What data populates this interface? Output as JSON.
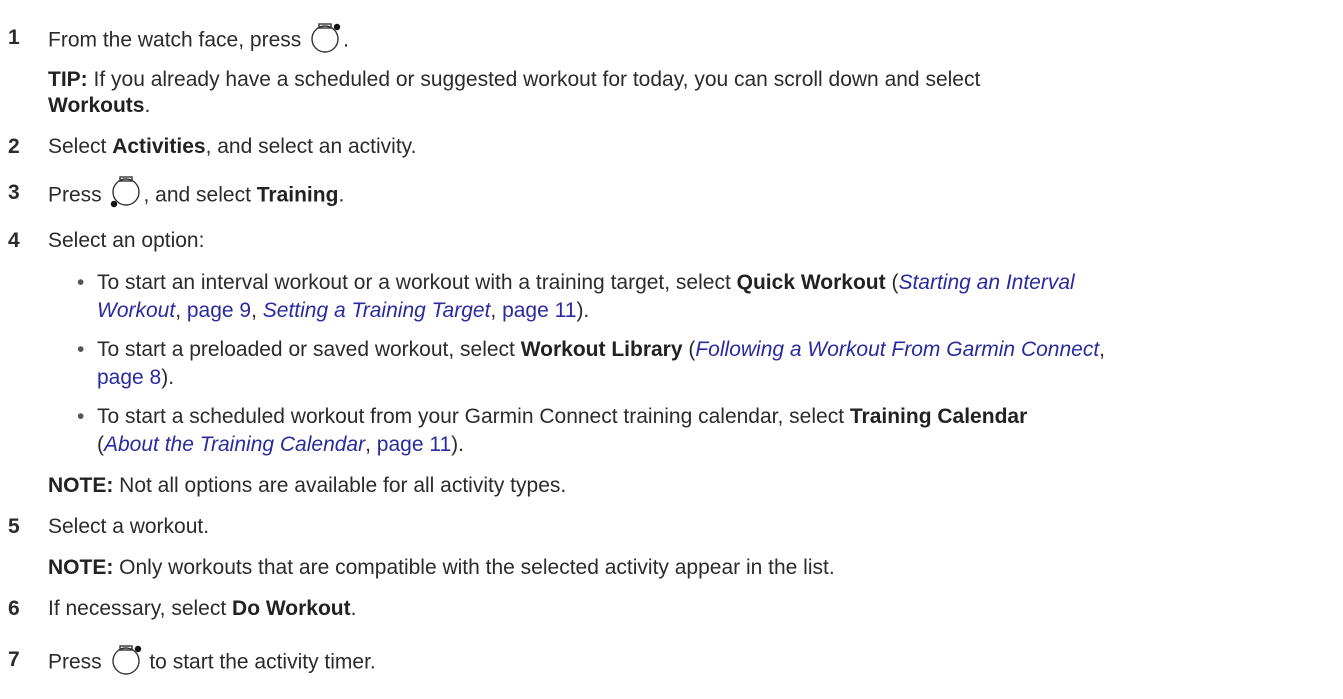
{
  "steps": [
    {
      "num": "1",
      "before": "From the watch face, press ",
      "after": ".",
      "icon": "watch-start-button-icon"
    },
    {
      "tip_label": "TIP:",
      "tip_text": " If you already have a scheduled or suggested workout for today, you can scroll down and select",
      "tip_bold": "Workouts",
      "tip_end": "."
    },
    {
      "num": "2",
      "a": "Select ",
      "b": "Activities",
      "c": ", and select an activity."
    },
    {
      "num": "3",
      "a": "Press ",
      "c1": ", and select ",
      "b": "Training",
      "c2": ".",
      "icon": "watch-menu-button-icon"
    },
    {
      "num": "4",
      "a": "Select an option:"
    },
    {
      "num": "5",
      "a": "Select a workout."
    },
    {
      "num": "6",
      "a": "If necessary, select ",
      "b": "Do Workout",
      "c": "."
    },
    {
      "num": "7",
      "a": "Press ",
      "c": " to start the activity timer.",
      "icon": "watch-start-button-icon"
    }
  ],
  "options": [
    {
      "l1a": "To start an interval workout or a workout with a training target, select ",
      "l1b": "Quick Workout",
      "l1c": " (",
      "l1link": "Starting an Interval",
      "l2link": "Workout",
      "l2a": ", ",
      "l2page1": "page 9",
      "l2b": ", ",
      "l2link2": "Setting a Training Target",
      "l2c": ", ",
      "l2page2": "page 11",
      "l2d": ")."
    },
    {
      "l1a": "To start a preloaded or saved workout, select ",
      "l1b": "Workout Library",
      "l1c": " (",
      "l1link": "Following a Workout From Garmin Connect",
      "l1d": ",",
      "l2page": "page 8",
      "l2a": ")."
    },
    {
      "l1a": "To start a scheduled workout from your Garmin Connect training calendar, select ",
      "l1b": "Training Calendar",
      "l2a": "(",
      "l2link": "About the Training Calendar",
      "l2b": ", ",
      "l2page": "page 11",
      "l2c": ")."
    }
  ],
  "note1": {
    "label": "NOTE:",
    "text": " Not all options are available for all activity types."
  },
  "note2": {
    "label": "NOTE:",
    "text": " Only workouts that are compatible with the selected activity appear in the list."
  },
  "colors": {
    "text": "#2b2b2b",
    "link": "#2a2aa0"
  }
}
